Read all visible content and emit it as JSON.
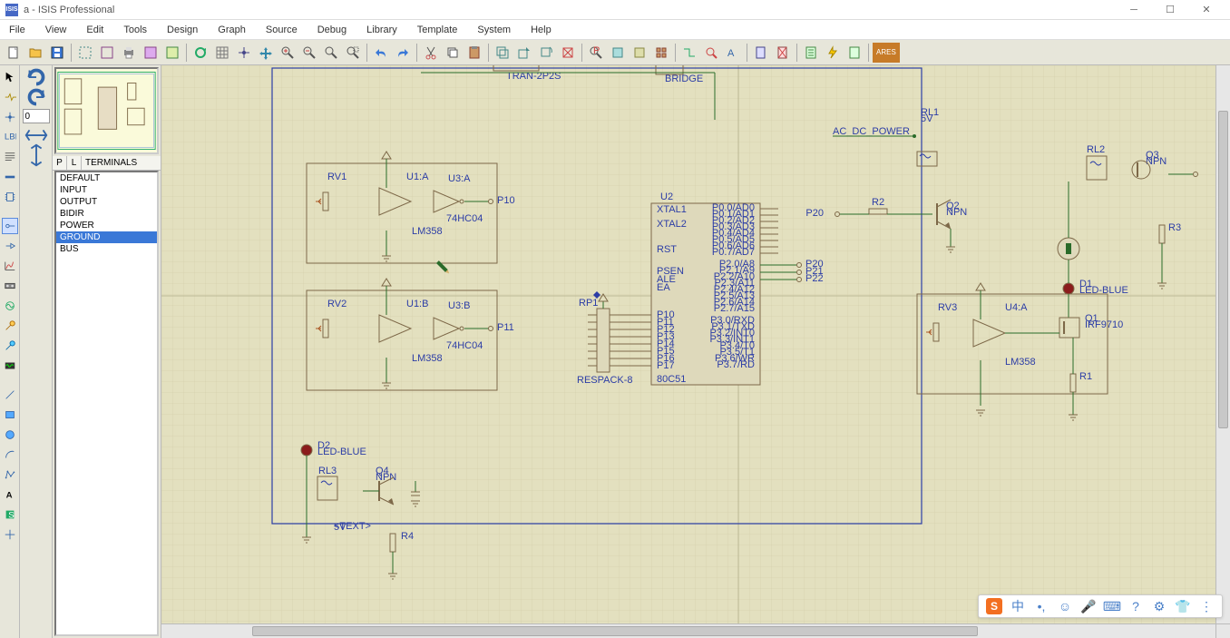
{
  "window": {
    "title": "a - ISIS Professional"
  },
  "menu": [
    "File",
    "View",
    "Edit",
    "Tools",
    "Design",
    "Graph",
    "Source",
    "Debug",
    "Library",
    "Template",
    "System",
    "Help"
  ],
  "rotation_input": "0",
  "sidebar": {
    "header_p": "P",
    "header_l": "L",
    "header_title": "TERMINALS",
    "items": [
      "DEFAULT",
      "INPUT",
      "OUTPUT",
      "BIDIR",
      "POWER",
      "GROUND",
      "BUS"
    ],
    "selected_index": 5
  },
  "toolbar_ares": "ARES",
  "schematic": {
    "components": {
      "RV1": "RV1",
      "RV2": "RV2",
      "RV3": "RV3",
      "U1A": "U1:A",
      "U1B": "U1:B",
      "U3A": "U3:A",
      "U3B": "U3:B",
      "U4A": "U4:A",
      "LM358_1": "LM358",
      "LM358_2": "LM358",
      "LM358_3": "LM358",
      "AHC04_1": "74HC04",
      "AHC04_2": "74HC04",
      "U2": "U2",
      "RP1": "RP1",
      "RESPACK": "RESPACK-8",
      "TRAN": "TRAN-2P2S",
      "BRIDGE": "BRIDGE",
      "RL1": "RL1",
      "RL2": "RL2",
      "RL3": "RL3",
      "R2": "R2",
      "R3": "R3",
      "R4": "R4",
      "Q1": "Q1",
      "IRF9710": "IRF9710",
      "Q2": "Q2",
      "Q3": "Q3",
      "Q4": "Q4",
      "NPN": "NPN",
      "D1": "D1",
      "LED_BLUE": "LED-BLUE",
      "D2": "D2",
      "D2_sub": "LED-BLUE",
      "P10": "P10",
      "P11": "P11",
      "P20": "P20",
      "P20R": "P20",
      "P21": "P21",
      "P22": "P22",
      "AC_DC": "AC_DC_POWER",
      "text_5v_1": "5V",
      "text_5v_2": "5V",
      "text_text": "<TEXT>",
      "chip_pins_left": [
        "XTAL1",
        "XTAL2",
        "",
        "RST",
        "",
        "PSEN",
        "ALE",
        "EA",
        "",
        "",
        "P10",
        "P11",
        "P12",
        "P13",
        "P14",
        "P15",
        "P16",
        "P17"
      ],
      "chip_pins_right": [
        "P0.0/AD0",
        "P0.1/AD1",
        "P0.2/AD2",
        "P0.3/AD3",
        "P0.4/AD4",
        "P0.5/AD5",
        "P0.6/AD6",
        "P0.7/AD7",
        "",
        "P2.0/A8",
        "P2.1/A9",
        "P2.2/A10",
        "P2.3/A11",
        "P2.4/A12",
        "P2.5/A13",
        "P2.6/A14",
        "P2.7/A15",
        "",
        "P3.0/RXD",
        "P3.1/TXD",
        "P3.2/INT0",
        "P3.3/INT1",
        "P3.4/T0",
        "P3.5/T1",
        "P3.6/WR",
        "P3.7/RD"
      ],
      "chip_bottom": "80C51"
    }
  },
  "ime": {
    "chars": [
      "中",
      "•,",
      "☺",
      "🎤",
      "⌨",
      "?",
      "⚙",
      "👕",
      "⋮"
    ]
  }
}
